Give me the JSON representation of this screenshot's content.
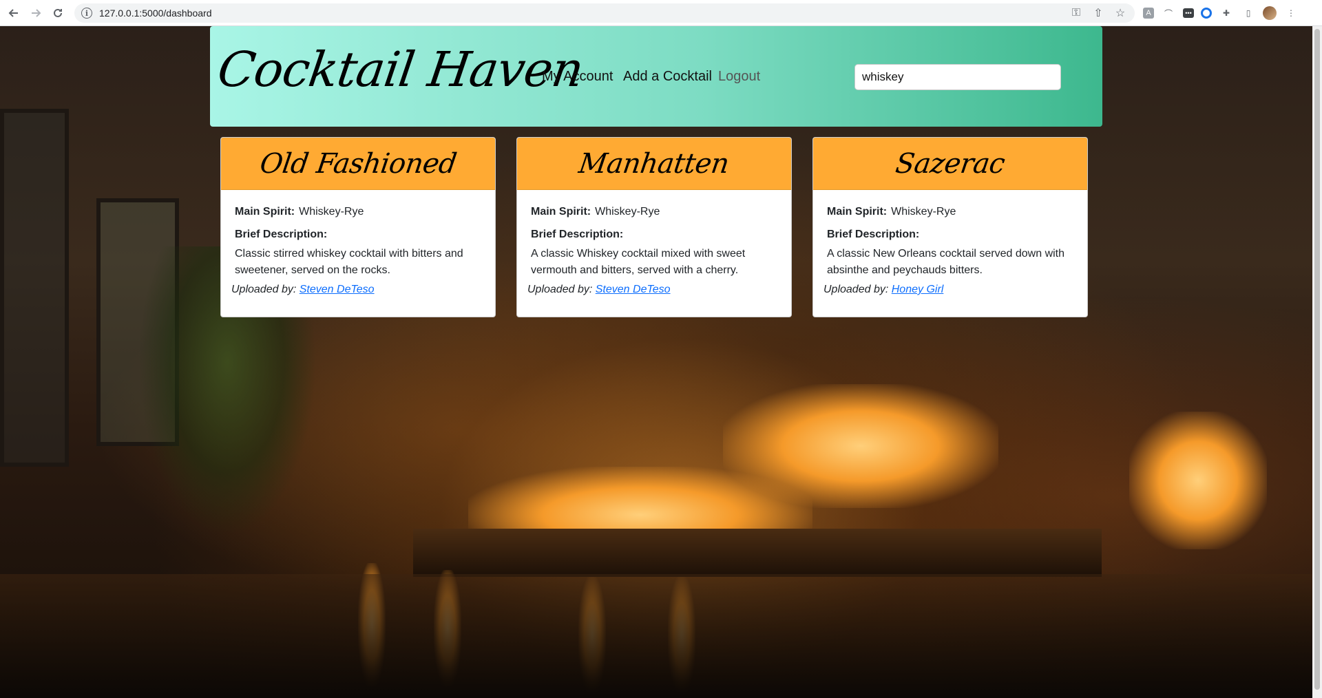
{
  "browser": {
    "url": "127.0.0.1:5000/dashboard"
  },
  "header": {
    "brand": "Cocktail Haven",
    "nav": {
      "my_account": "My Account",
      "add_cocktail": "Add a Cocktail",
      "logout": "Logout"
    },
    "search_value": "whiskey"
  },
  "labels": {
    "main_spirit": "Main Spirit:",
    "brief_description": "Brief Description:",
    "uploaded_by": "Uploaded by:"
  },
  "cocktails": [
    {
      "name": "Old Fashioned",
      "main_spirit": "Whiskey-Rye",
      "description": "Classic stirred whiskey cocktail with bitters and sweetener, served on the rocks.",
      "uploader": "Steven DeTeso"
    },
    {
      "name": "Manhatten",
      "main_spirit": "Whiskey-Rye",
      "description": "A classic Whiskey cocktail mixed with sweet vermouth and bitters, served with a cherry.",
      "uploader": "Steven DeTeso"
    },
    {
      "name": "Sazerac",
      "main_spirit": "Whiskey-Rye",
      "description": "A classic New Orleans cocktail served down with absinthe and peychauds bitters.",
      "uploader": "Honey Girl"
    }
  ],
  "colors": {
    "header_gradient_start": "#a9f5e6",
    "header_gradient_end": "#3db88e",
    "card_header": "#ffaa33",
    "link": "#0d6efd"
  }
}
